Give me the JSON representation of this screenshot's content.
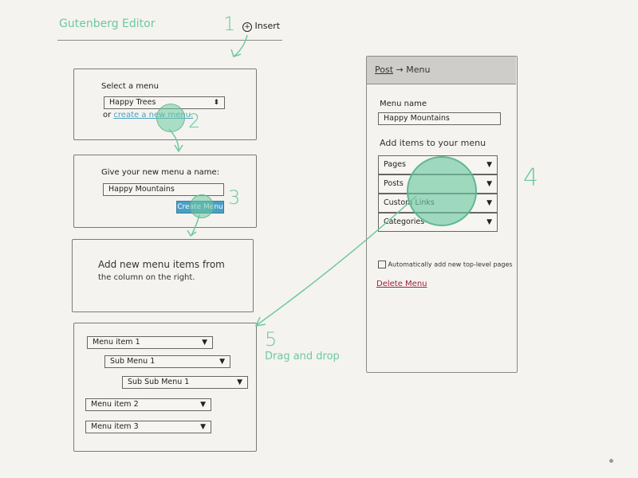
{
  "header": {
    "title": "Gutenberg Editor"
  },
  "steps": {
    "step1": "1",
    "insert_label": "Insert",
    "step2": "2",
    "step3": "3",
    "step4": "4",
    "step5": "5",
    "drag_drop": "Drag and drop"
  },
  "box1": {
    "label": "Select a menu",
    "selected": "Happy Trees",
    "or_text": "or",
    "create_link": "create a new menu."
  },
  "box2": {
    "label": "Give your new menu a name:",
    "input_value": "Happy Mountains",
    "button": "Create Menu"
  },
  "box3": {
    "text_line1": "Add new menu items from",
    "text_line2": "the column on the right."
  },
  "box4": {
    "items": [
      {
        "label": "Menu item 1"
      },
      {
        "label": "Sub Menu 1"
      },
      {
        "label": "Sub Sub Menu 1"
      },
      {
        "label": "Menu item 2"
      },
      {
        "label": "Menu item 3"
      }
    ]
  },
  "sidebar": {
    "breadcrumb_post": "Post",
    "breadcrumb_arrow": "→",
    "breadcrumb_menu": "Menu",
    "name_label": "Menu name",
    "name_value": "Happy Mountains",
    "add_heading": "Add items to your menu",
    "sources": [
      {
        "label": "Pages"
      },
      {
        "label": "Posts"
      },
      {
        "label": "Custom Links"
      },
      {
        "label": "Categories"
      }
    ],
    "auto_add": "Automatically add new top-level pages",
    "delete": "Delete Menu"
  },
  "colors": {
    "accent_green": "#6fc8a0",
    "link_blue": "#4aa1c0",
    "delete_red": "#a0223f",
    "button_blue": "#4a9fc5"
  }
}
